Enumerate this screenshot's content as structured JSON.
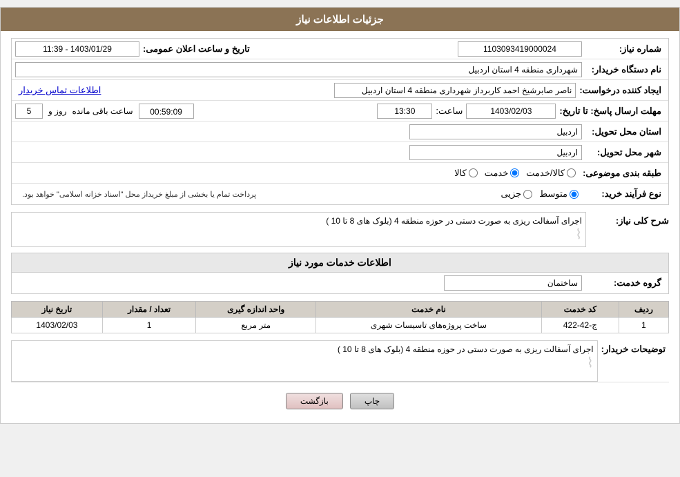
{
  "header": {
    "title": "جزئیات اطلاعات نیاز"
  },
  "fields": {
    "shomara_niaz_label": "شماره نیاز:",
    "shomara_niaz_value": "1103093419000024",
    "name_dasgah_label": "نام دستگاه خریدار:",
    "name_dasgah_value": "شهرداری منطقه 4 استان اردبیل",
    "ijad_konande_label": "ایجاد کننده درخواست:",
    "ijad_konande_value": "ناصر صابرشیخ احمد کاربرداز شهرداری منطقه 4 استان اردبیل",
    "ettelaat_link": "اطلاعات تماس خریدار",
    "mohlat_label": "مهلت ارسال پاسخ: تا تاریخ:",
    "mohlat_date": "1403/02/03",
    "mohlat_time_label": "ساعت:",
    "mohlat_time": "13:30",
    "mohlat_roz_label": "روز و",
    "mohlat_roz": "5",
    "mohlat_saat": "00:59:09",
    "mohlat_saat_mande_label": "ساعت باقی مانده",
    "ostan_label": "استان محل تحویل:",
    "ostan_value": "اردبیل",
    "shahr_label": "شهر محل تحویل:",
    "shahr_value": "اردبیل",
    "tabaqe_label": "طبقه بندی موضوعی:",
    "tabaqe_kala": "کالا",
    "tabaqe_khedmat": "خدمت",
    "tabaqe_kala_khedmat": "کالا/خدمت",
    "tabaqe_selected": "khedmat",
    "nooe_farayand_label": "نوع فرآیند خرید:",
    "nooe_jozi": "جزیی",
    "nooe_motovaset": "متوسط",
    "nooe_note": "پرداخت تمام یا بخشی از مبلغ خریداز محل \"اسناد خزانه اسلامی\" خواهد بود.",
    "nooe_selected": "motovaset",
    "tarikh_elan_label": "تاریخ و ساعت اعلان عمومی:",
    "tarikh_elan_value": "1403/01/29 - 11:39"
  },
  "sharh_niaz": {
    "section_title": "شرح کلی نیاز:",
    "value": "اجرای آسفالت ریزی به صورت دستی در حوزه منطقه 4 (بلوک های 8 تا 10 )"
  },
  "ettelaat_khedamat": {
    "section_title": "اطلاعات خدمات مورد نیاز",
    "gorohe_khedmat_label": "گروه خدمت:",
    "gorohe_khedmat_value": "ساختمان"
  },
  "table": {
    "headers": [
      "ردیف",
      "کد خدمت",
      "نام خدمت",
      "واحد اندازه گیری",
      "تعداد / مقدار",
      "تاریخ نیاز"
    ],
    "rows": [
      {
        "radif": "1",
        "kod_khedmat": "ج-42-422",
        "naam_khedmat": "ساخت پروژه‌های تاسیسات شهری",
        "vahed": "متر مربع",
        "tedad": "1",
        "tarikh": "1403/02/03"
      }
    ]
  },
  "tozihat": {
    "label": "توضیحات خریدار:",
    "value": "اجرای آسفالت ریزی به صورت دستی در حوزه منطقه 4 (بلوک های 8 تا 10 )"
  },
  "buttons": {
    "print": "چاپ",
    "back": "بازگشت"
  }
}
